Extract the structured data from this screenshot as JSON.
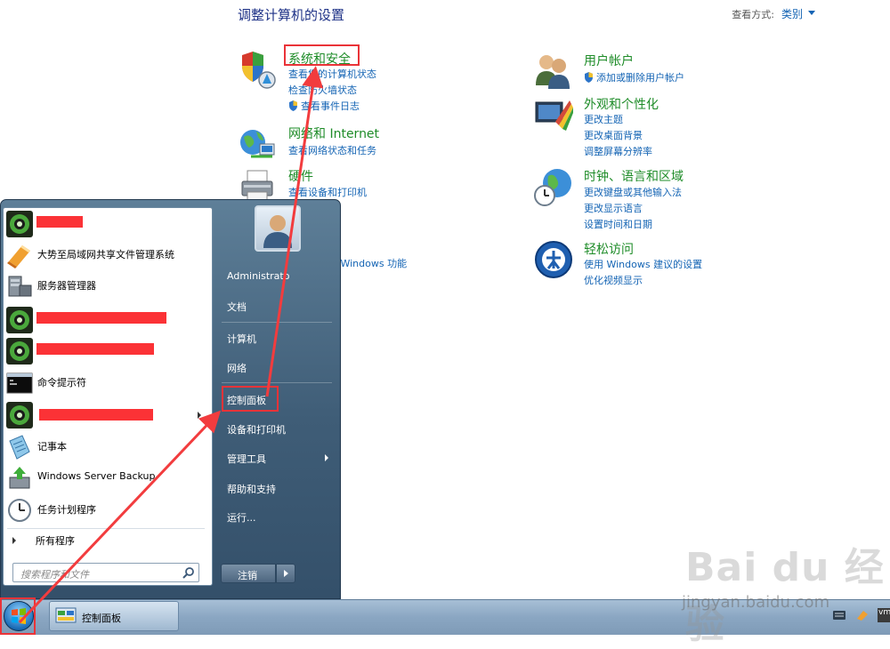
{
  "control_panel": {
    "title": "调整计算机的设置",
    "view_by_label": "查看方式:",
    "view_by_value": "类别",
    "categories_left": [
      {
        "title": "系统和安全",
        "links": [
          "查看您的计算机状态",
          "检查防火墙状态",
          "查看事件日志"
        ]
      },
      {
        "title": "网络和 Internet",
        "links": [
          "查看网络状态和任务"
        ]
      },
      {
        "title": "硬件",
        "links": [
          "查看设备和打印机"
        ]
      },
      {
        "title": "",
        "links": [
          "打开或关闭 Windows 功能"
        ]
      }
    ],
    "categories_right": [
      {
        "title": "用户帐户",
        "links": [
          "添加或删除用户帐户"
        ]
      },
      {
        "title": "外观和个性化",
        "links": [
          "更改主题",
          "更改桌面背景",
          "调整屏幕分辨率"
        ]
      },
      {
        "title": "时钟、语言和区域",
        "links": [
          "更改键盘或其他输入法",
          "更改显示语言",
          "设置时间和日期"
        ]
      },
      {
        "title": "轻松访问",
        "links": [
          "使用 Windows 建议的设置",
          "优化视频显示"
        ]
      }
    ]
  },
  "start_menu": {
    "programs": [
      {
        "label": "",
        "redacted": true
      },
      {
        "label": "大势至局域网共享文件管理系统"
      },
      {
        "label": "服务器管理器"
      },
      {
        "label": "",
        "redacted": true
      },
      {
        "label": "",
        "redacted": true
      },
      {
        "label": "命令提示符"
      },
      {
        "label": "",
        "redacted": true,
        "submenu": true
      },
      {
        "label": "记事本"
      },
      {
        "label": "Windows Server Backup"
      },
      {
        "label": "任务计划程序"
      }
    ],
    "all_programs": "所有程序",
    "search_placeholder": "搜索程序和文件",
    "user_name": "Administrato",
    "right_items": [
      "文档",
      "计算机",
      "网络",
      "控制面板",
      "设备和打印机",
      "管理工具",
      "帮助和支持",
      "运行..."
    ],
    "logout_label": "注销"
  },
  "taskbar": {
    "task_label": "控制面板"
  },
  "watermark": {
    "logo": "Bai du 经验",
    "url": "jingyan.baidu.com"
  },
  "colors": {
    "highlight": "#ea3338",
    "arrow": "#f23c3e",
    "link": "#1464b4",
    "category": "#1e8c28"
  }
}
